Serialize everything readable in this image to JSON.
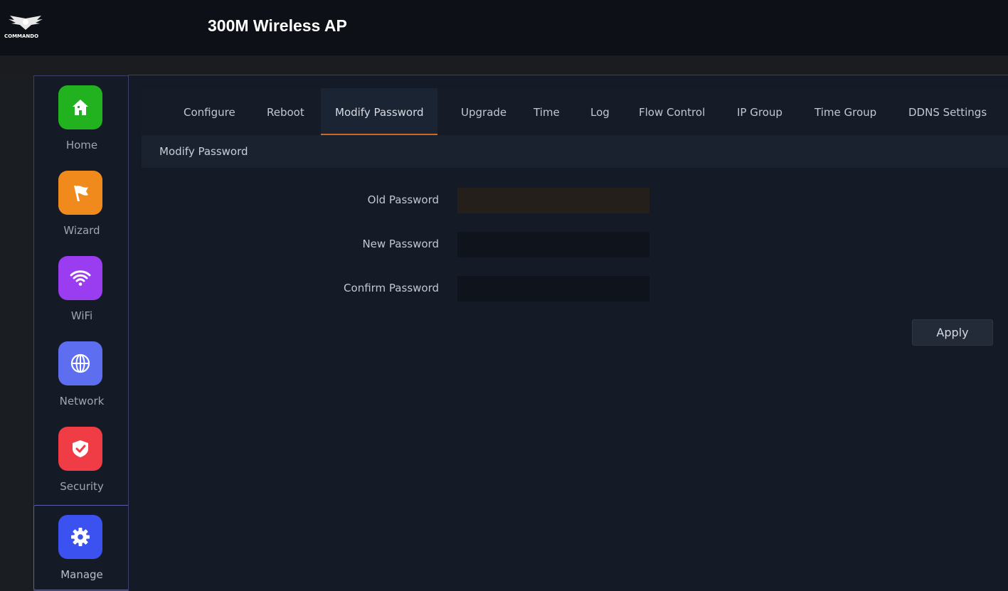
{
  "header": {
    "logo_text": "COMMANDO",
    "title": "300M Wireless AP"
  },
  "sidebar": {
    "items": [
      {
        "label": "Home",
        "icon": "home-icon",
        "color": "#22b21f"
      },
      {
        "label": "Wizard",
        "icon": "flag-icon",
        "color": "#f08a1d"
      },
      {
        "label": "WiFi",
        "icon": "wifi-icon",
        "color": "#9a3cf0"
      },
      {
        "label": "Network",
        "icon": "globe-icon",
        "color": "#5d6ff0"
      },
      {
        "label": "Security",
        "icon": "shield-icon",
        "color": "#ef3c45"
      },
      {
        "label": "Manage",
        "icon": "gear-icon",
        "color": "#3b52f0"
      }
    ],
    "active": "Manage"
  },
  "tabs": [
    {
      "label": "Configure"
    },
    {
      "label": "Reboot"
    },
    {
      "label": "Modify Password"
    },
    {
      "label": "Upgrade"
    },
    {
      "label": "Time"
    },
    {
      "label": "Log"
    },
    {
      "label": "Flow Control"
    },
    {
      "label": "IP Group"
    },
    {
      "label": "Time Group"
    },
    {
      "label": "DDNS Settings"
    }
  ],
  "active_tab": "Modify Password",
  "section": {
    "title": "Modify Password"
  },
  "form": {
    "old_password": {
      "label": "Old Password",
      "value": ""
    },
    "new_password": {
      "label": "New Password",
      "value": ""
    },
    "confirm_password": {
      "label": "Confirm Password",
      "value": ""
    }
  },
  "apply_label": "Apply",
  "colors": {
    "accent_tab_underline": "#c96a2a",
    "old_password_field_bg": "#241f1a",
    "field_bg": "#0e131c"
  }
}
